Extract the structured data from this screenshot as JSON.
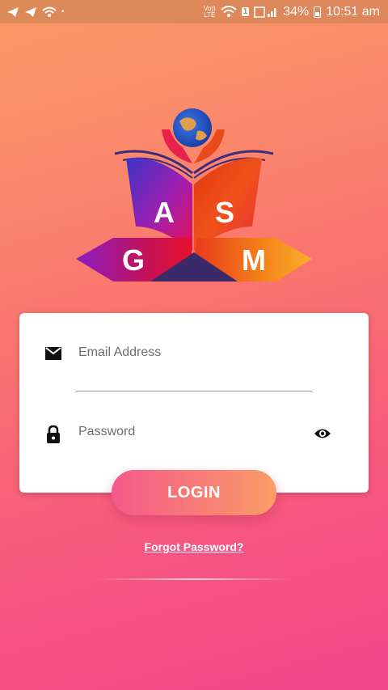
{
  "status_bar": {
    "volte_top": "Vo))",
    "volte_bottom": "LTE",
    "sim": "1",
    "battery": "34%",
    "time": "10:51 am"
  },
  "logo": {
    "letters": [
      "A",
      "S",
      "G",
      "M"
    ]
  },
  "login_form": {
    "email_placeholder": "Email Address",
    "password_placeholder": "Password"
  },
  "login_button": "LOGIN",
  "forgot_password": "Forgot Password?",
  "icons": {
    "email": "mail-icon",
    "password": "lock-icon",
    "visibility": "eye-icon"
  },
  "colors": {
    "gradient_top": "#fb9a64",
    "gradient_bottom": "#f4468a",
    "button_left": "#f45a8a",
    "button_right": "#fb9d66"
  }
}
